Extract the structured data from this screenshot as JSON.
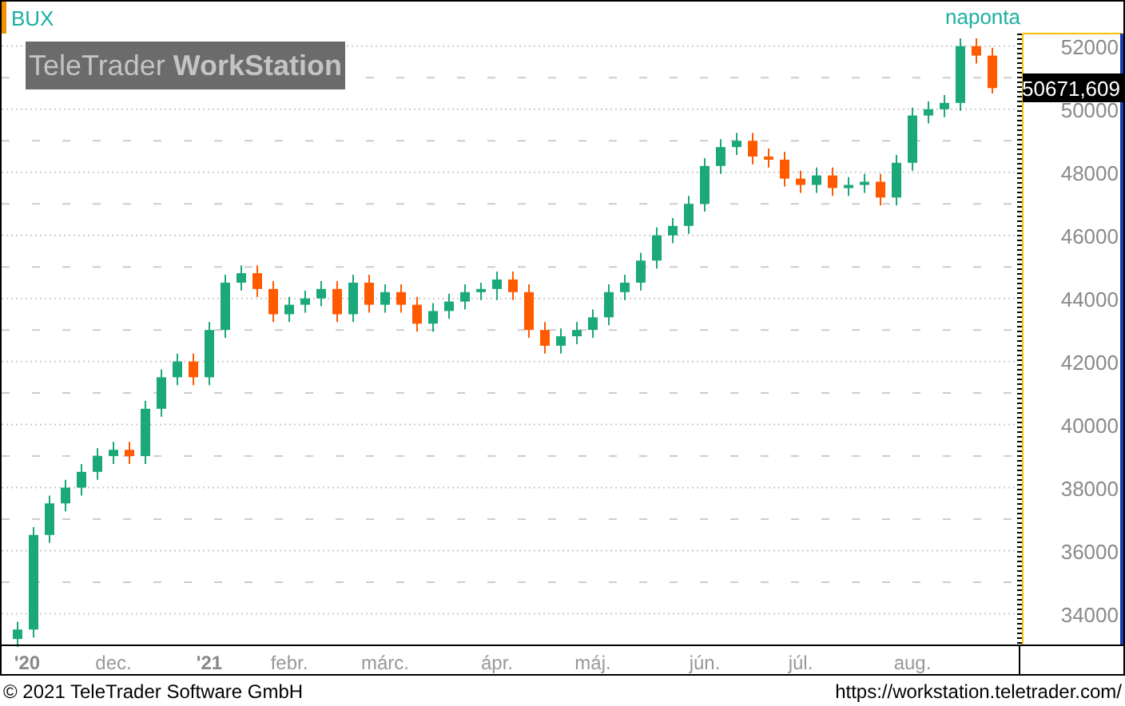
{
  "header": {
    "symbol": "BUX",
    "interval": "naponta"
  },
  "logo": "TeleTrader **WorkStation**",
  "last_value": "50671,609",
  "chart_data": {
    "type": "candlestick",
    "grid": true,
    "ylim": [
      33000,
      52400
    ],
    "yticks": [
      34000,
      36000,
      38000,
      40000,
      42000,
      44000,
      46000,
      48000,
      50000,
      52000
    ],
    "categories": [
      "'20",
      null,
      null,
      null,
      null,
      null,
      "dec.",
      null,
      null,
      null,
      null,
      null,
      "'21",
      null,
      null,
      null,
      null,
      "febr.",
      null,
      null,
      null,
      null,
      null,
      "márc.",
      null,
      null,
      null,
      null,
      null,
      null,
      "ápr.",
      null,
      null,
      null,
      null,
      null,
      "máj.",
      null,
      null,
      null,
      null,
      null,
      null,
      "jún.",
      null,
      null,
      null,
      null,
      null,
      "júl.",
      null,
      null,
      null,
      null,
      null,
      null,
      "aug.",
      null,
      null,
      null,
      null,
      null
    ],
    "ohlc": [
      [
        33200,
        33750,
        32950,
        33500
      ],
      [
        33500,
        36750,
        33250,
        36500
      ],
      [
        36500,
        37750,
        36250,
        37500
      ],
      [
        37500,
        38250,
        37250,
        38000
      ],
      [
        38000,
        38750,
        37750,
        38500
      ],
      [
        38500,
        39250,
        38250,
        39000
      ],
      [
        39000,
        39450,
        38750,
        39200
      ],
      [
        39200,
        39450,
        38750,
        39000
      ],
      [
        39000,
        40750,
        38750,
        40500
      ],
      [
        40500,
        41750,
        40250,
        41500
      ],
      [
        41500,
        42250,
        41250,
        42000
      ],
      [
        42000,
        42250,
        41250,
        41500
      ],
      [
        41500,
        43250,
        41250,
        43000
      ],
      [
        43000,
        44750,
        42750,
        44500
      ],
      [
        44500,
        45050,
        44250,
        44800
      ],
      [
        44800,
        45050,
        44050,
        44300
      ],
      [
        44300,
        44550,
        43250,
        43500
      ],
      [
        43500,
        44050,
        43250,
        43800
      ],
      [
        43800,
        44250,
        43550,
        44000
      ],
      [
        44000,
        44550,
        43750,
        44300
      ],
      [
        44300,
        44550,
        43250,
        43500
      ],
      [
        43500,
        44750,
        43250,
        44500
      ],
      [
        44500,
        44750,
        43550,
        43800
      ],
      [
        43800,
        44450,
        43550,
        44200
      ],
      [
        44200,
        44450,
        43550,
        43800
      ],
      [
        43800,
        44050,
        42950,
        43200
      ],
      [
        43200,
        43850,
        42950,
        43600
      ],
      [
        43600,
        44150,
        43350,
        43900
      ],
      [
        43900,
        44450,
        43650,
        44200
      ],
      [
        44200,
        44500,
        43950,
        44300
      ],
      [
        44300,
        44850,
        43950,
        44600
      ],
      [
        44600,
        44850,
        43950,
        44200
      ],
      [
        44200,
        44450,
        42750,
        43000
      ],
      [
        43000,
        43250,
        42250,
        42500
      ],
      [
        42500,
        43050,
        42250,
        42800
      ],
      [
        42800,
        43250,
        42550,
        43000
      ],
      [
        43000,
        43650,
        42750,
        43400
      ],
      [
        43400,
        44450,
        43150,
        44200
      ],
      [
        44200,
        44750,
        43950,
        44500
      ],
      [
        44500,
        45450,
        44250,
        45200
      ],
      [
        45200,
        46250,
        44950,
        46000
      ],
      [
        46000,
        46550,
        45750,
        46300
      ],
      [
        46300,
        47250,
        46050,
        47000
      ],
      [
        47000,
        48450,
        46750,
        48200
      ],
      [
        48200,
        49050,
        47950,
        48800
      ],
      [
        48800,
        49250,
        48550,
        49000
      ],
      [
        49000,
        49250,
        48250,
        48500
      ],
      [
        48500,
        48750,
        48150,
        48400
      ],
      [
        48400,
        48650,
        47550,
        47800
      ],
      [
        47800,
        48050,
        47350,
        47600
      ],
      [
        47600,
        48150,
        47350,
        47900
      ],
      [
        47900,
        48150,
        47250,
        47500
      ],
      [
        47500,
        47850,
        47250,
        47600
      ],
      [
        47600,
        47950,
        47350,
        47700
      ],
      [
        47700,
        47950,
        46950,
        47200
      ],
      [
        47200,
        48550,
        46950,
        48300
      ],
      [
        48300,
        50050,
        48050,
        49800
      ],
      [
        49800,
        50250,
        49550,
        50000
      ],
      [
        50000,
        50450,
        49750,
        50200
      ],
      [
        50200,
        52250,
        49950,
        52000
      ],
      [
        52000,
        52250,
        51450,
        51700
      ],
      [
        51700,
        51950,
        50500,
        50670
      ]
    ]
  },
  "footer": {
    "copyright": "© 2021 TeleTrader Software GmbH",
    "url": "https://workstation.teletrader.com/"
  }
}
